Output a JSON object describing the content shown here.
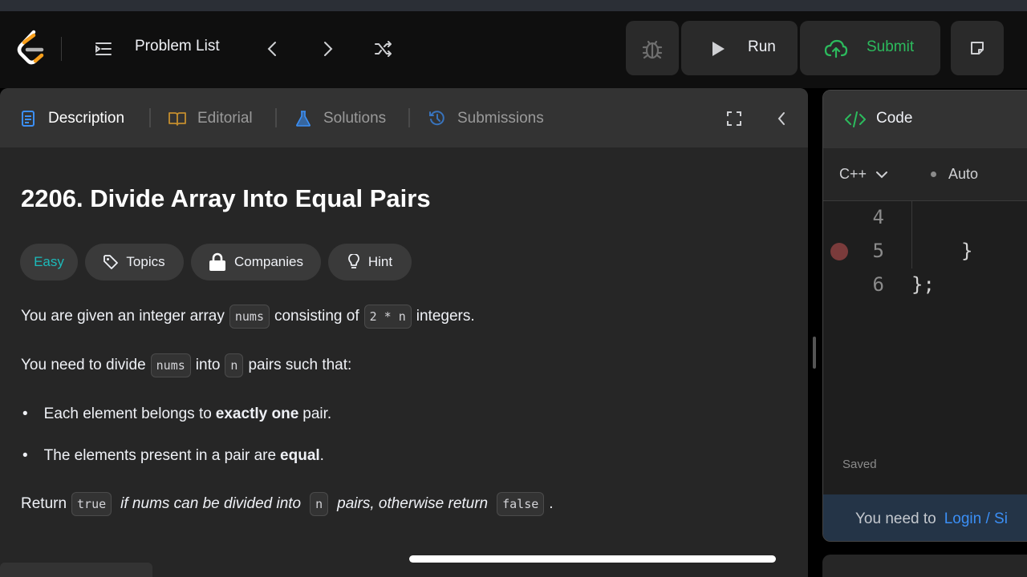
{
  "topbar": {
    "problem_list_label": "Problem List",
    "run_label": "Run",
    "submit_label": "Submit"
  },
  "description": {
    "tabs": [
      {
        "label": "Description"
      },
      {
        "label": "Editorial"
      },
      {
        "label": "Solutions"
      },
      {
        "label": "Submissions"
      }
    ],
    "title": "2206. Divide Array Into Equal Pairs",
    "chips": {
      "difficulty": "Easy",
      "topics": "Topics",
      "companies": "Companies",
      "hint": "Hint"
    },
    "p1": {
      "a": "You are given an integer array",
      "code1": "nums",
      "b": "consisting of",
      "code2": "2 * n",
      "c": "integers."
    },
    "p2": {
      "a": "You need to divide",
      "code1": "nums",
      "b": "into",
      "code2": "n",
      "c": "pairs such that:"
    },
    "bullets": [
      {
        "a": "Each element belongs to",
        "bold": "exactly one",
        "b": "pair."
      },
      {
        "a": "The elements present in a pair are",
        "bold": "equal",
        "b": "."
      }
    ],
    "p3": {
      "a": "Return",
      "code1": "true",
      "em1": "if nums can be divided into",
      "code2": "n",
      "em2": "pairs, otherwise return",
      "code3": "false",
      "c": "."
    }
  },
  "editor": {
    "tab_label": "Code",
    "language": "C++",
    "mode": "Auto",
    "lines": [
      {
        "num": "4",
        "text": ""
      },
      {
        "num": "5",
        "text": "}"
      },
      {
        "num": "6",
        "text": "};"
      }
    ],
    "saved_label": "Saved",
    "login_prompt": "You need to",
    "login_link": "Login / Si"
  },
  "colors": {
    "accent_green": "#2cbb5d",
    "link_blue": "#3b8ff6",
    "easy_teal": "#1cbaba",
    "editorial_orange": "#c48e2e",
    "tab_blue": "#3b8ff6"
  }
}
